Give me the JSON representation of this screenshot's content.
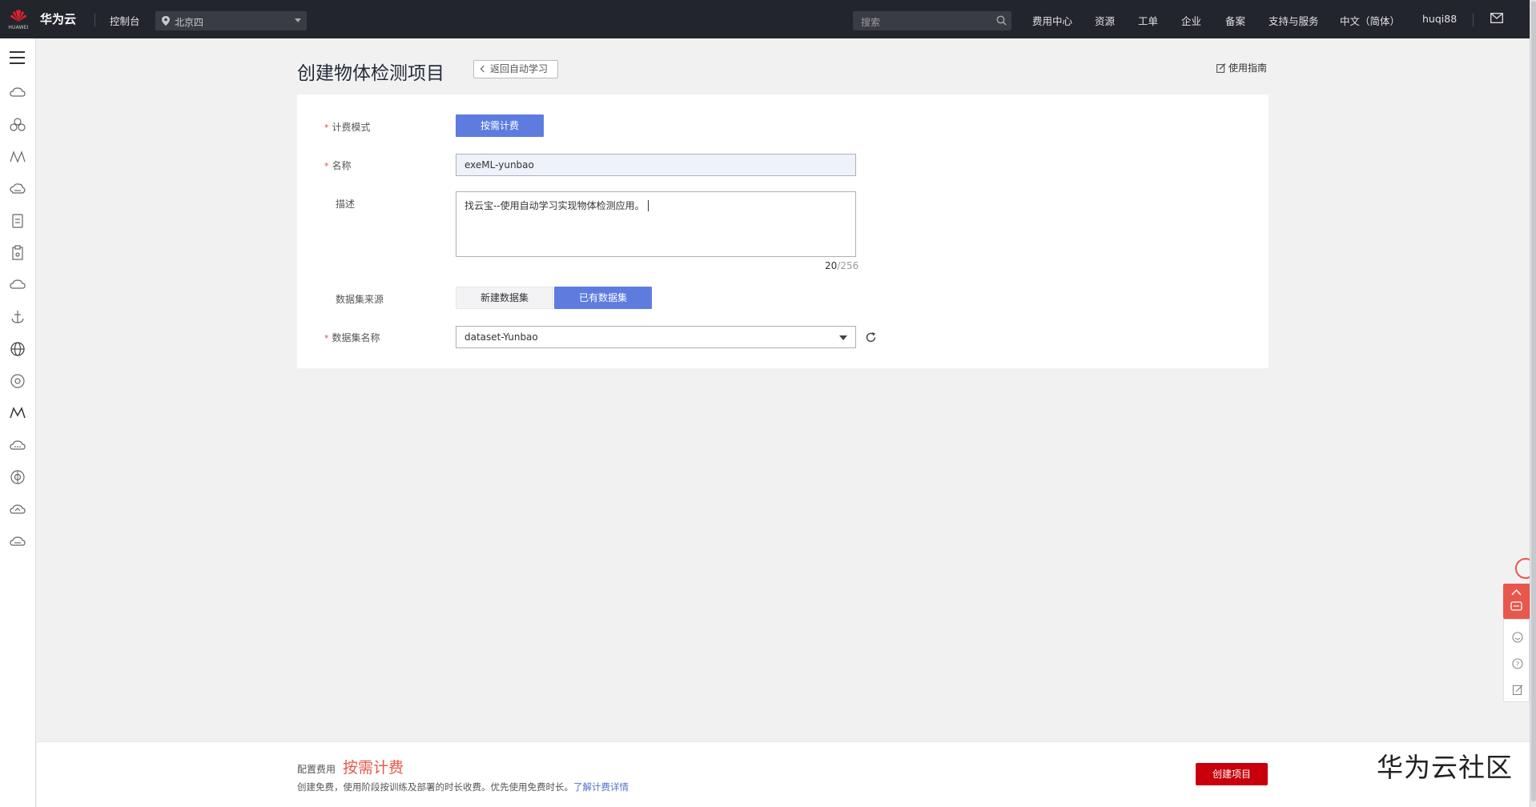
{
  "topbar": {
    "logo_text": "HUAWEI",
    "brand": "华为云",
    "console": "控制台",
    "region": "北京四",
    "search_placeholder": "搜索",
    "nav": [
      "费用中心",
      "资源",
      "工单",
      "企业",
      "备案",
      "支持与服务",
      "中文（简体）",
      "huqi88"
    ]
  },
  "page": {
    "title": "创建物体检测项目",
    "back_label": "返回自动学习",
    "guide_label": "使用指南"
  },
  "form": {
    "billing": {
      "label": "计费模式",
      "button": "按需计费"
    },
    "name": {
      "label": "名称",
      "value": "exeML-yunbao"
    },
    "desc": {
      "label": "描述",
      "value": "找云宝--使用自动学习实现物体检测应用。",
      "count": "20",
      "max": "/256"
    },
    "source": {
      "label": "数据集来源",
      "options": [
        "新建数据集",
        "已有数据集"
      ],
      "selected": "已有数据集"
    },
    "dataset": {
      "label": "数据集名称",
      "value": "dataset-Yunbao"
    }
  },
  "footer": {
    "fee_label": "配置费用",
    "fee_mode": "按需计费",
    "note": "创建免费，使用阶段按训练及部署的时长收费。优先使用免费时长。",
    "link": "了解计费详情",
    "create_button": "创建项目"
  },
  "watermark": "华为云社区",
  "colors": {
    "topbar": "#23252c",
    "primary": "#5e7ce0",
    "accent_red": "#c7000b",
    "fee_red": "#e8574c"
  },
  "icons": {
    "sidebar": [
      "cloud-icon",
      "cluster-icon",
      "network-icon",
      "storage-icon",
      "document-icon",
      "clipboard-icon",
      "cloud-icon",
      "anchor-icon",
      "globe-icon",
      "compass-icon",
      "mountain-icon",
      "cloud-chat-icon",
      "settings-globe-icon",
      "cloud-up-icon",
      "cloud-more-icon"
    ]
  }
}
